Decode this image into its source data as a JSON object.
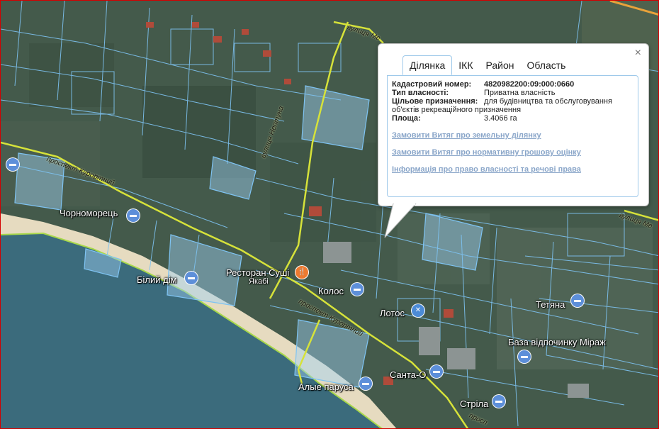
{
  "popup": {
    "close_glyph": "×",
    "tabs": [
      {
        "label": "Ділянка",
        "active": true
      },
      {
        "label": "ІКК",
        "active": false
      },
      {
        "label": "Район",
        "active": false
      },
      {
        "label": "Область",
        "active": false
      }
    ],
    "fields": {
      "cadastral": {
        "label": "Кадастровий номер:",
        "value": "4820982200:09:000:0660"
      },
      "ownership": {
        "label": "Тип власності:",
        "value": "Приватна власність"
      },
      "purpose": {
        "label": "Цільове призначення:",
        "value": "для будівництва та обслуговування об'єктів рекреаційного призначення"
      },
      "area": {
        "label": "Площа:",
        "value": "3.4066 га"
      }
    },
    "links": [
      "Замовити Витяг про земельну ділянку",
      "Замовити Витяг про нормативну грошову оцінку",
      "Інформація про право власності та речові права"
    ]
  },
  "map": {
    "places": {
      "chornomorets": "Чорноморець",
      "bilyi_dim": "Білий дім",
      "restaurant": "Ресторан Суші",
      "yakabi": "Якабі",
      "kolos": "Колос",
      "lotos": "Лотос",
      "santa": "Санта-О",
      "tetiana": "Тетяна",
      "mirazh": "База відпочинку Міраж",
      "alye_parusa": "Алые паруса",
      "strila": "Стріла"
    },
    "streets": {
      "prospekt_kurortnyi_1": "проспект Курортний",
      "prospekt_kurortnyi_2": "проспект Курортний",
      "prospekt_kurortnyi_3": "просп",
      "street_ne_1": "вулиця Ме",
      "street_diag": "вулиця Нептуна",
      "street_right": "вулиця Ме"
    },
    "colors": {
      "sea": "#3b6b7c",
      "beach": "#e8dcc0",
      "land": "#4a5f50",
      "parcel_line": "#7ec3f2",
      "parcel_fill": "#9fd2f6",
      "road": "#d6e23a",
      "accent_border": "#d40000"
    }
  }
}
